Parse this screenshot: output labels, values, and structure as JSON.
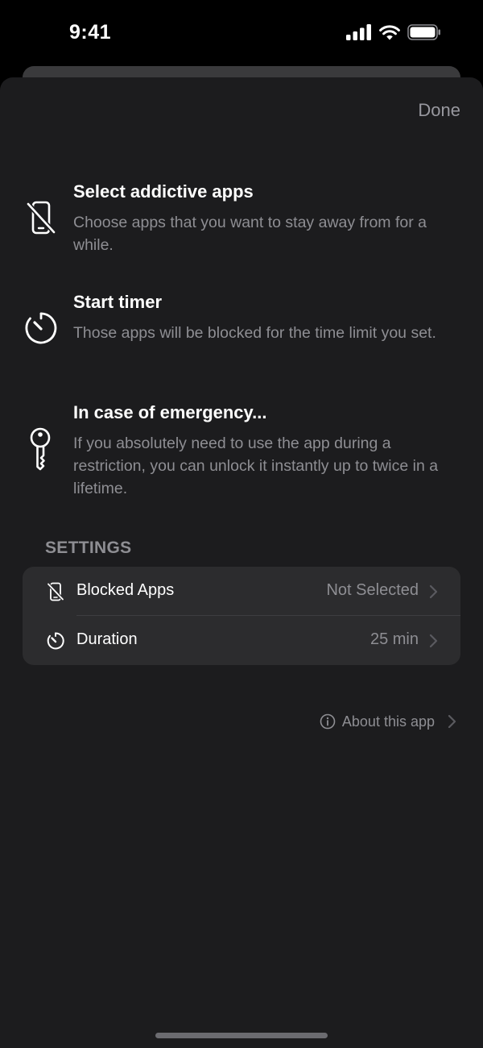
{
  "status_bar": {
    "time": "9:41"
  },
  "header": {
    "done_label": "Done"
  },
  "features": [
    {
      "icon": "phone-slash-icon",
      "title": "Select addictive apps",
      "description": "Choose apps that you want to stay away from for a while."
    },
    {
      "icon": "timer-icon",
      "title": "Start timer",
      "description": "Those apps will be blocked for the time limit you set."
    },
    {
      "icon": "key-icon",
      "title": "In case of emergency...",
      "description": "If you absolutely need to use the app during a restriction, you can unlock it instantly up to twice in a lifetime."
    }
  ],
  "settings": {
    "header": "SETTINGS",
    "rows": [
      {
        "icon": "phone-slash-icon",
        "label": "Blocked Apps",
        "value": "Not Selected"
      },
      {
        "icon": "timer-icon",
        "label": "Duration",
        "value": "25 min"
      }
    ]
  },
  "about": {
    "icon": "info-circle-icon",
    "label": "About this app"
  },
  "colors": {
    "sheet_background": "#1c1c1e",
    "group_background": "#2c2c2e",
    "secondary_text": "#8e8e93"
  }
}
